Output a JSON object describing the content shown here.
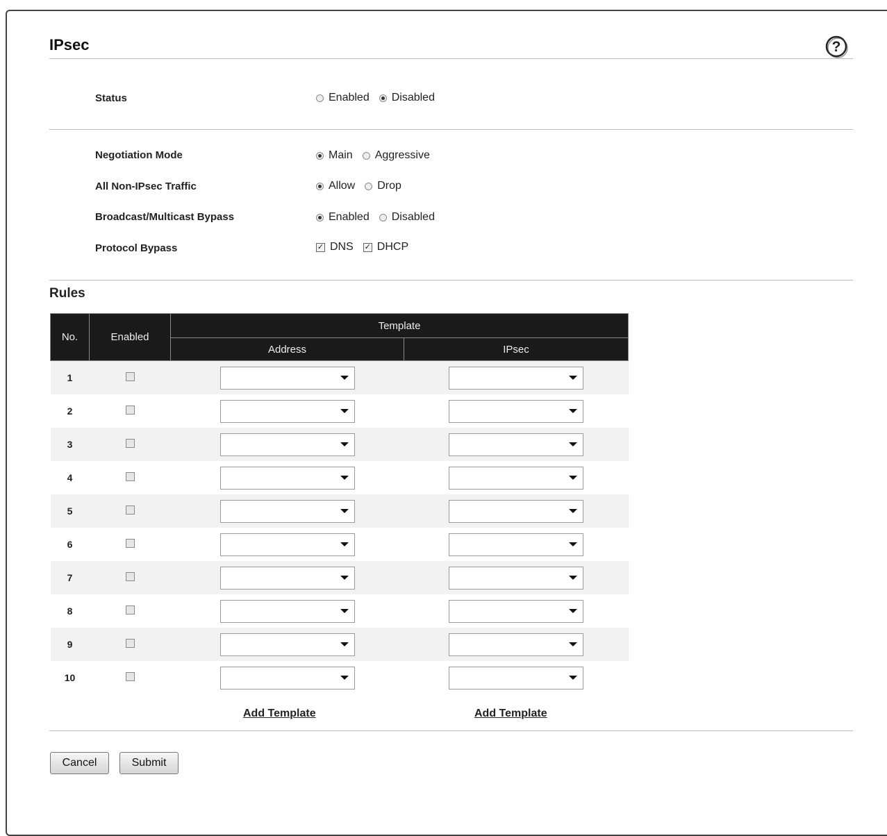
{
  "page": {
    "title": "IPsec"
  },
  "settings": {
    "status": {
      "label": "Status",
      "options": [
        {
          "label": "Enabled",
          "selected": false
        },
        {
          "label": "Disabled",
          "selected": true
        }
      ]
    },
    "negotiation_mode": {
      "label": "Negotiation Mode",
      "options": [
        {
          "label": "Main",
          "selected": true
        },
        {
          "label": "Aggressive",
          "selected": false
        }
      ]
    },
    "non_ipsec_traffic": {
      "label": "All Non-IPsec Traffic",
      "options": [
        {
          "label": "Allow",
          "selected": true
        },
        {
          "label": "Drop",
          "selected": false
        }
      ]
    },
    "broadcast_bypass": {
      "label": "Broadcast/Multicast Bypass",
      "options": [
        {
          "label": "Enabled",
          "selected": true
        },
        {
          "label": "Disabled",
          "selected": false
        }
      ]
    },
    "protocol_bypass": {
      "label": "Protocol Bypass",
      "options": [
        {
          "label": "DNS",
          "checked": true
        },
        {
          "label": "DHCP",
          "checked": true
        }
      ]
    }
  },
  "rules": {
    "title": "Rules",
    "headers": {
      "no": "No.",
      "enabled": "Enabled",
      "template": "Template",
      "address": "Address",
      "ipsec": "IPsec"
    },
    "rows": [
      {
        "no": "1",
        "enabled": false,
        "address": "",
        "ipsec": ""
      },
      {
        "no": "2",
        "enabled": false,
        "address": "",
        "ipsec": ""
      },
      {
        "no": "3",
        "enabled": false,
        "address": "",
        "ipsec": ""
      },
      {
        "no": "4",
        "enabled": false,
        "address": "",
        "ipsec": ""
      },
      {
        "no": "5",
        "enabled": false,
        "address": "",
        "ipsec": ""
      },
      {
        "no": "6",
        "enabled": false,
        "address": "",
        "ipsec": ""
      },
      {
        "no": "7",
        "enabled": false,
        "address": "",
        "ipsec": ""
      },
      {
        "no": "8",
        "enabled": false,
        "address": "",
        "ipsec": ""
      },
      {
        "no": "9",
        "enabled": false,
        "address": "",
        "ipsec": ""
      },
      {
        "no": "10",
        "enabled": false,
        "address": "",
        "ipsec": ""
      }
    ],
    "add_address_template": "Add Template",
    "add_ipsec_template": "Add Template"
  },
  "buttons": {
    "cancel": "Cancel",
    "submit": "Submit"
  },
  "icons": {
    "help": "help-icon",
    "dropdown": "chevron-down-icon"
  }
}
